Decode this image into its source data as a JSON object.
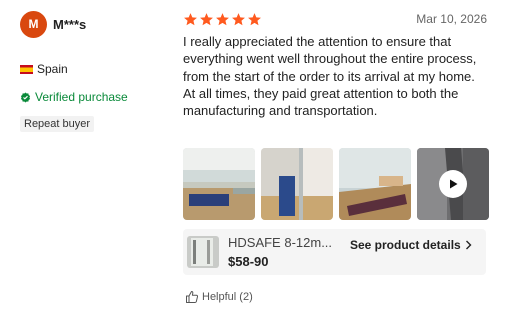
{
  "reviewer": {
    "avatar_initial": "M",
    "name": "M***s",
    "country": "Spain",
    "verified_label": "Verified purchase",
    "repeat_label": "Repeat buyer"
  },
  "review": {
    "rating": 5,
    "rating_max": 5,
    "date": "Mar 10, 2026",
    "text": "I really appreciated the attention to ensure that everything went well throughout the entire process, from the start of the order to its arrival at my home. At all times, they paid great attention to both the manufacturing and transportation."
  },
  "photos": [
    {
      "kind": "image"
    },
    {
      "kind": "image"
    },
    {
      "kind": "image"
    },
    {
      "kind": "video",
      "icon": "play-icon"
    }
  ],
  "product": {
    "title": "HDSAFE 8-12m...",
    "price": "$58-90",
    "details_label": "See product details"
  },
  "helpful": {
    "label": "Helpful (2)"
  },
  "colors": {
    "star": "#ff5a1f",
    "avatar": "#d9480f",
    "verified": "#0a8a3a"
  }
}
